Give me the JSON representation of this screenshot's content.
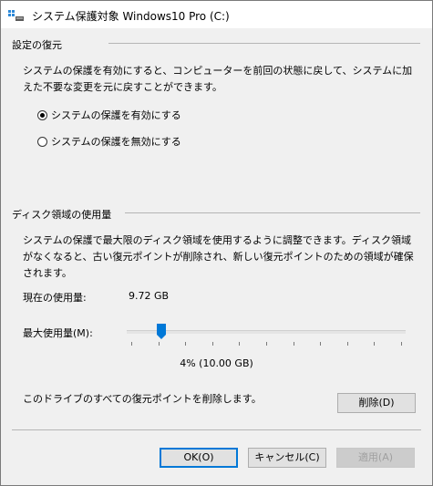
{
  "window": {
    "title": "システム保護対象 Windows10 Pro (C:)"
  },
  "restore_settings": {
    "header": "設定の復元",
    "description": "システムの保護を有効にすると、コンピューターを前回の状態に戻して、システムに加えた不要な変更を元に戻すことができます。",
    "options": [
      {
        "label": "システムの保護を有効にする",
        "selected": true
      },
      {
        "label": "システムの保護を無効にする",
        "selected": false
      }
    ]
  },
  "disk_usage": {
    "header": "ディスク領域の使用量",
    "description": "システムの保護で最大限のディスク領域を使用するように調整できます。ディスク領域がなくなると、古い復元ポイントが削除され、新しい復元ポイントのための領域が確保されます。",
    "current_label": "現在の使用量:",
    "current_value": "9.72 GB",
    "max_label": "最大使用量(M):",
    "max_percent": 4,
    "max_value_text": "4% (10.00 GB)",
    "delete_text": "このドライブのすべての復元ポイントを削除します。",
    "delete_button": "削除(D)"
  },
  "buttons": {
    "ok": "OK(O)",
    "cancel": "キャンセル(C)",
    "apply": "適用(A)"
  },
  "colors": {
    "accent": "#0078d7",
    "thumb": "#0078d7"
  }
}
